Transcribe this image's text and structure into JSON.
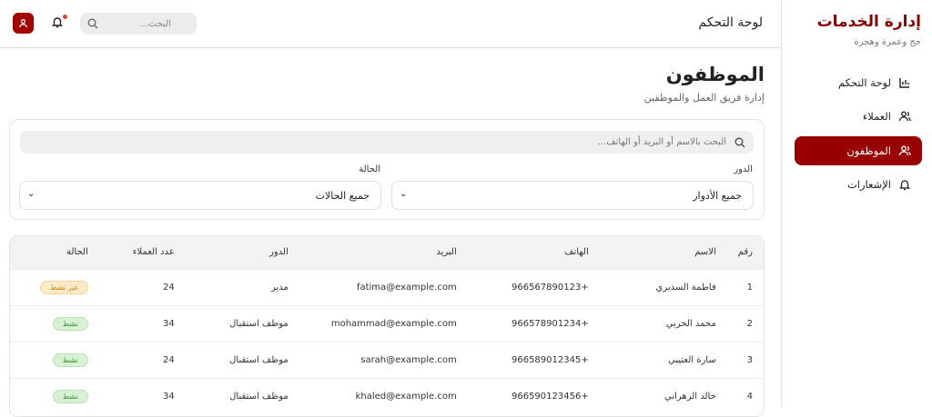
{
  "sidebar": {
    "brand": "إدارة الخدمات",
    "subtitle": "حج وعمرة وهجرة",
    "items": [
      {
        "label": "لوحة التحكم",
        "icon": "chart-icon"
      },
      {
        "label": "العملاء",
        "icon": "users-icon"
      },
      {
        "label": "الموظفون",
        "icon": "users-icon",
        "active": true
      },
      {
        "label": "الإشعارات",
        "icon": "bell-icon"
      }
    ]
  },
  "header": {
    "title": "لوحة التحكم",
    "search_placeholder": "البحث..."
  },
  "page": {
    "title": "الموظفون",
    "subtitle": "إدارة فريق العمل والموظفين"
  },
  "filters": {
    "search_placeholder": "البحث بالاسم أو البريد أو الهاتف...",
    "role_label": "الدور",
    "role_value": "جميع الأدوار",
    "status_label": "الحالة",
    "status_value": "جميع الحالات"
  },
  "table": {
    "headers": [
      "رقم",
      "الاسم",
      "الهاتف",
      "البريد",
      "الدور",
      "عدد العملاء",
      "الحالة"
    ],
    "rows": [
      {
        "id": "1",
        "name": "فاطمة السديري",
        "phone": "+966567890123",
        "email": "fatima@example.com",
        "role": "مدير",
        "clients": "24",
        "status": "غير نشط",
        "active": false
      },
      {
        "id": "2",
        "name": "محمد الحربي",
        "phone": "+966578901234",
        "email": "mohammad@example.com",
        "role": "موظف استقبال",
        "clients": "34",
        "status": "نشط",
        "active": true
      },
      {
        "id": "3",
        "name": "سارة العتيبي",
        "phone": "+966589012345",
        "email": "sarah@example.com",
        "role": "موظف استقبال",
        "clients": "24",
        "status": "نشط",
        "active": true
      },
      {
        "id": "4",
        "name": "خالد الزهراني",
        "phone": "+966590123456",
        "email": "khaled@example.com",
        "role": "موظف استقبال",
        "clients": "34",
        "status": "نشط",
        "active": true
      }
    ]
  },
  "colors": {
    "brand": "#990000",
    "active_badge_bg": "#d8f0d4",
    "active_badge_fg": "#3a9a3a",
    "inactive_badge_bg": "#fdebc8",
    "inactive_badge_fg": "#d08a20"
  }
}
